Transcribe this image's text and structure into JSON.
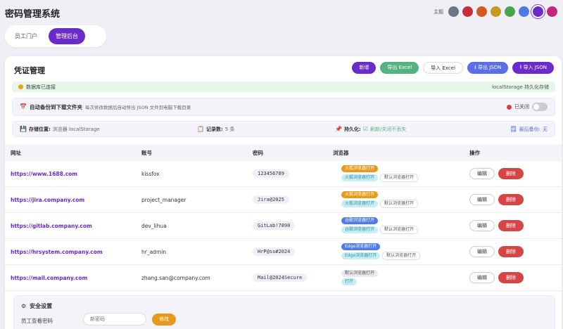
{
  "app": {
    "title": "密码管理系统"
  },
  "theme": {
    "label": "主题",
    "swatches": [
      "#6c7588",
      "#c62f3a",
      "#d6591f",
      "#c69a22",
      "#4aa54a",
      "#4c7be6",
      "#6b2bc9",
      "#c2277a"
    ],
    "active_index": 6
  },
  "tabs": [
    {
      "label": "员工门户",
      "active": false
    },
    {
      "label": "管理后台",
      "active": true
    }
  ],
  "panel": {
    "title": "凭证管理",
    "toolbar": {
      "add": "新增",
      "export_excel": "导出 Excel",
      "import_excel": "导入 Excel",
      "export_json": "导出 JSON",
      "import_json": "导入 JSON"
    }
  },
  "status": {
    "connected": "数据库已连接",
    "storage_note": "localStorage 持久化存储"
  },
  "backup": {
    "title": "自动备份到下载文件夹",
    "desc": "每次修改数据后自动导出 JSON 文件到电脑下载目录",
    "state": "已关闭"
  },
  "info": {
    "location_label": "存储位置:",
    "location_value": "浏览器 localStorage",
    "count_label": "记录数:",
    "count_value": "5 条",
    "persist_label": "持久化:",
    "persist_value": "刷新/关闭不丢失",
    "last_backup_label": "最后备份:",
    "last_backup_value": "无"
  },
  "table": {
    "headers": {
      "url": "网址",
      "account": "账号",
      "password": "密码",
      "browser": "浏览器",
      "ops": "操作"
    },
    "edit_label": "编辑",
    "delete_label": "删除",
    "rows": [
      {
        "url": "https://www.1688.com",
        "account": "kissfox",
        "password": "123456789",
        "browser_primary": "火狐浏览器打开",
        "browser_secondary": "火狐浏览器打开",
        "browser_default": "默认浏览器打开",
        "primary_color": "orange",
        "secondary_color": "cyan"
      },
      {
        "url": "https://jira.company.com",
        "account": "project_manager",
        "password": "Jira@2025",
        "browser_primary": "火狐浏览器打开",
        "browser_secondary": "火狐浏览器打开",
        "browser_default": "默认浏览器打开",
        "primary_color": "orange",
        "secondary_color": "cyan"
      },
      {
        "url": "https://gitlab.company.com",
        "account": "dev_lihua",
        "password": "GitLab!7890",
        "browser_primary": "谷歌浏览器打开",
        "browser_secondary": "谷歌浏览器打开",
        "browser_default": "默认浏览器打开",
        "primary_color": "blue",
        "secondary_color": "cyan"
      },
      {
        "url": "https://hrsystem.company.com",
        "account": "hr_admin",
        "password": "HrP@ss#2024",
        "browser_primary": "Edge浏览器打开",
        "browser_secondary": "Edge浏览器打开",
        "browser_default": "默认浏览器打开",
        "primary_color": "blue",
        "secondary_color": "cyan"
      },
      {
        "url": "https://mail.company.com",
        "account": "zhang.san@company.com",
        "password": "Mail@2024Secure",
        "browser_primary": "默认浏览器打开",
        "browser_secondary": "打开",
        "browser_default": "",
        "primary_color": "gray",
        "secondary_color": "cyan"
      }
    ]
  },
  "security": {
    "title": "安全设置",
    "label": "员工查看密码",
    "placeholder": "新密码",
    "button": "修改"
  }
}
